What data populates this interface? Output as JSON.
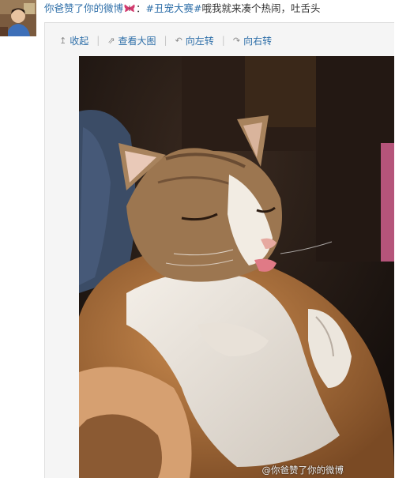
{
  "post": {
    "author": "你爸赞了你的微博",
    "separator": "：",
    "hashtag": "#丑宠大赛#",
    "text": "哦我就来凑个热闹，吐舌头"
  },
  "toolbar": {
    "collapse_label": "收起",
    "view_large_label": "查看大图",
    "rotate_left_label": "向左转",
    "rotate_right_label": "向右转",
    "separator": "|"
  },
  "photo": {
    "watermark": "@你爸赞了你的微博"
  },
  "icons": {
    "collapse": "arrow-up-icon",
    "view_large": "external-view-icon",
    "rotate_left": "rotate-left-icon",
    "rotate_right": "rotate-right-icon",
    "badge": "butterfly-icon"
  },
  "colors": {
    "link": "#2d6ea8",
    "card_bg": "#f5f5f5",
    "badge": "#d23b6e"
  }
}
